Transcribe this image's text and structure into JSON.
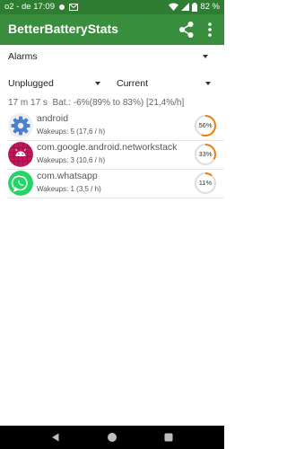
{
  "status_bar": {
    "carrier_time": "o2 - de 17:09",
    "battery": "82 %"
  },
  "app_bar": {
    "title": "BetterBatteryStats"
  },
  "filters": {
    "stat_type": "Alarms",
    "reference_from": "Unplugged",
    "reference_to": "Current"
  },
  "summary": {
    "duration": "17 m 17 s",
    "battery": "Bat.: -6%(89% to 83%) [21,4%/h]"
  },
  "alarms": [
    {
      "name": "android",
      "wakeups": "Wakeups: 5 (17,6 / h)",
      "percent_label": "56%",
      "percent": 56,
      "icon": "settings-gear-icon",
      "color": "#f57c00"
    },
    {
      "name": "com.google.android.networkstack",
      "wakeups": "Wakeups: 3 (10,6 / h)",
      "percent_label": "33%",
      "percent": 33,
      "icon": "android-robot-icon",
      "color": "#f57c00"
    },
    {
      "name": "com.whatsapp",
      "wakeups": "Wakeups: 1 (3,5 / h)",
      "percent_label": "11%",
      "percent": 11,
      "icon": "whatsapp-icon",
      "color": "#f57c00"
    }
  ]
}
